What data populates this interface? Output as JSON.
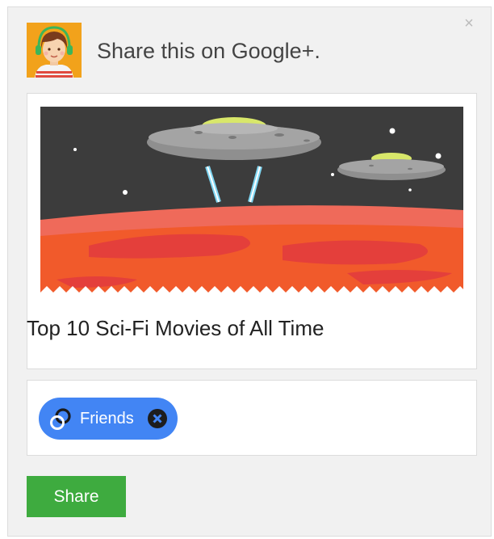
{
  "dialog": {
    "title": "Share this on Google+.",
    "close_label": "×"
  },
  "card": {
    "title": "Top 10 Sci-Fi Movies of All Time"
  },
  "audience": {
    "chips": [
      {
        "label": "Friends",
        "icon": "circles-icon",
        "remove_icon": "remove-icon"
      }
    ]
  },
  "actions": {
    "share_label": "Share"
  },
  "colors": {
    "dialog_bg": "#f1f1f1",
    "chip_blue": "#4285f4",
    "share_green": "#3eab3f",
    "avatar_bg": "#f2a21b"
  }
}
